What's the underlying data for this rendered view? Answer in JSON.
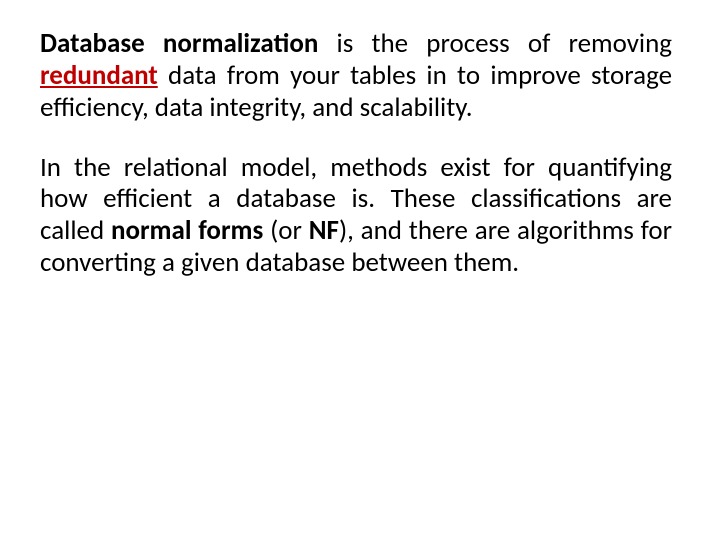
{
  "p1": {
    "s1": "Database normalization",
    "s2": " is the process of removing ",
    "s3": "redundant",
    "s4": " data from your tables in to improve storage efficiency, data integrity, and scalability."
  },
  "p2": {
    "s1": "In the relational model, methods exist for quantifying how efficient a database is. These classifications are called ",
    "s2": "normal forms",
    "s3": " (or ",
    "s4": "NF",
    "s5": "), and there are algorithms for converting a given database between them."
  }
}
